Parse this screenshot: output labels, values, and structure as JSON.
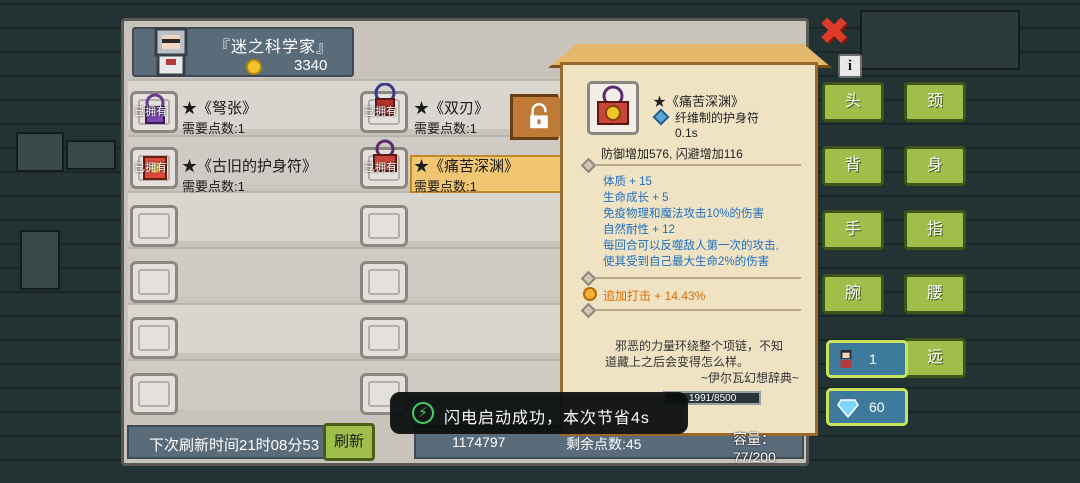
{
  "player": {
    "title": "『迷之科学家』",
    "gold": "3340"
  },
  "items": [
    {
      "owned_label": "已拥有",
      "name": "★《弩张》",
      "points": "需要点数:1"
    },
    {
      "owned_label": "已拥有",
      "name": "★《双刃》",
      "points": "需要点数:1"
    },
    {
      "owned_label": "已拥有",
      "name": "★《古旧的护身符》",
      "points": "需要点数:1"
    },
    {
      "owned_label": "已拥有",
      "name": "★《痛苦深渊》",
      "points": "需要点数:1"
    }
  ],
  "refresh": {
    "label": "下次刷新时间21时08分53",
    "button": "刷新"
  },
  "bottom": {
    "gold_partial": "1174797",
    "remaining_partial": "剩余点数:45",
    "capacity": "容量：77/200"
  },
  "tooltip": {
    "name": "★《痛苦深渊》",
    "type": "纤维制的护身符",
    "time": "0.1s",
    "defense": "防御增加576, 闪避增加116",
    "stats": [
      "体质 + 15",
      "生命成长 + 5",
      "免疫物理和魔法攻击10%的伤害",
      "自然耐性 + 12",
      "每回合可以反噬敌人第一次的攻击,",
      "使其受到自己最大生命2%的伤害"
    ],
    "bonus": "追加打击 + 14.43%",
    "lore": [
      "邪恶的力量环绕整个项链，不知",
      "道藏上之后会变得怎么样。",
      "~伊尔瓦幻想辞典~"
    ],
    "exp": "1991/8500"
  },
  "equip_slots": [
    {
      "label": "头"
    },
    {
      "label": "颈"
    },
    {
      "label": "背"
    },
    {
      "label": "身"
    },
    {
      "label": "手"
    },
    {
      "label": "指"
    },
    {
      "label": "腕"
    },
    {
      "label": "腰"
    },
    {
      "label": "远"
    }
  ],
  "resources": {
    "character_count": "1",
    "diamonds": "60"
  },
  "toast": {
    "text": "闪电启动成功，本次节省4s"
  },
  "icons": {
    "close": "✖",
    "info": "i",
    "lock": "lock-icon",
    "lightning": "⚡"
  },
  "colors": {
    "accent_green": "#9fbf4a",
    "tooltip_bg": "#efe3c4",
    "stat_blue": "#1e6fc1",
    "bonus_orange": "#d96c00"
  }
}
